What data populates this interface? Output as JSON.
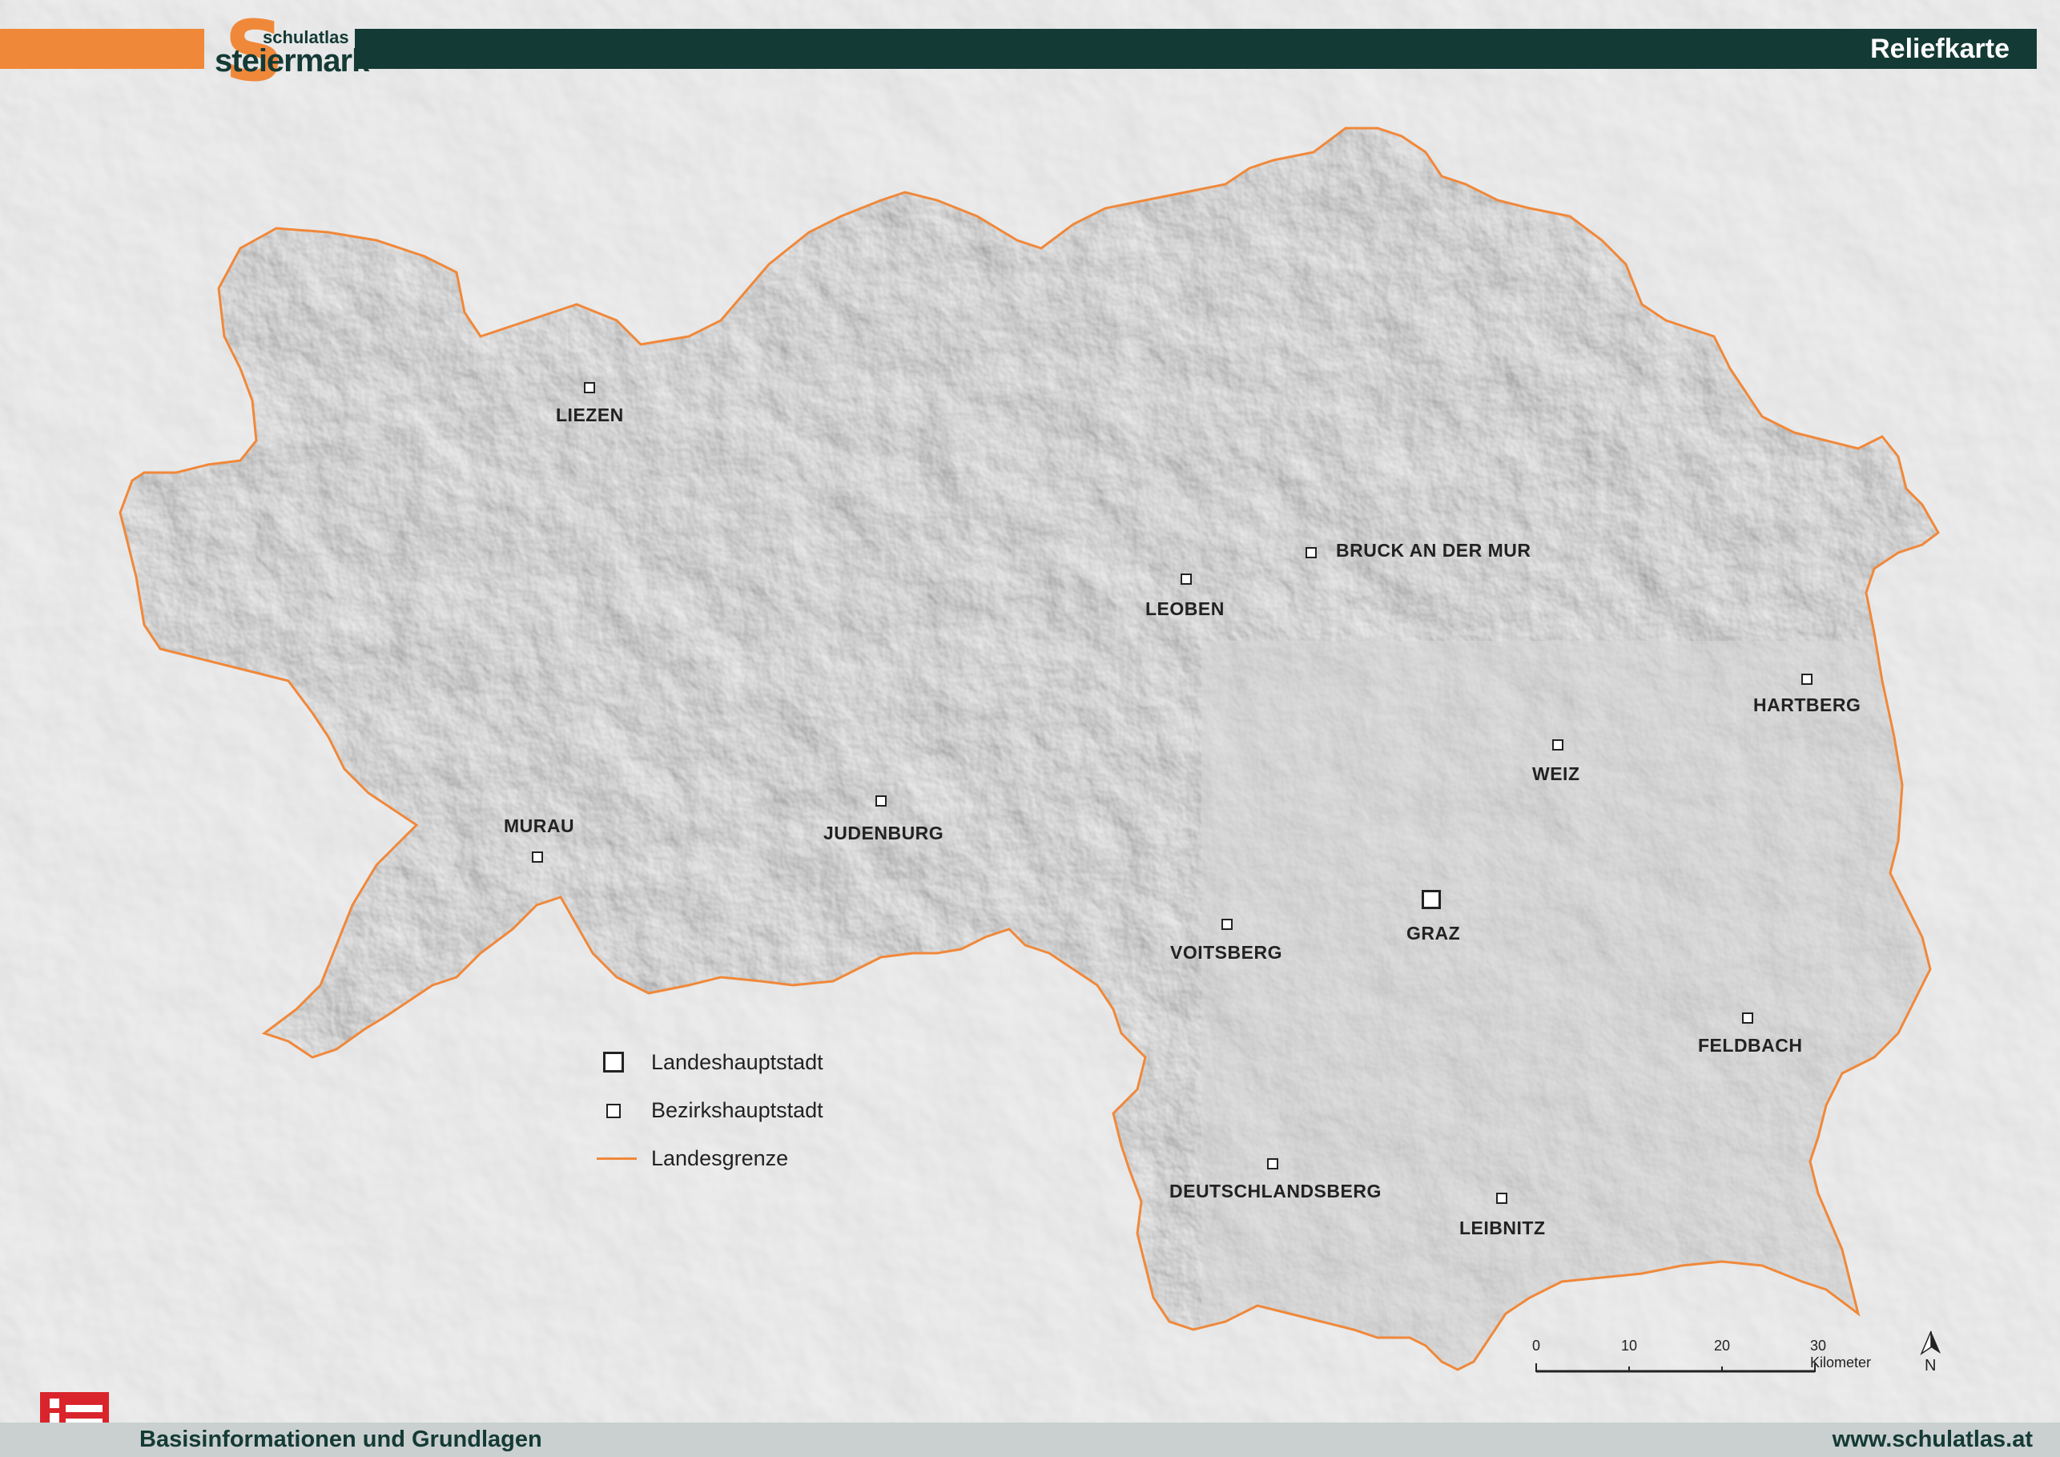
{
  "header": {
    "title": "Reliefkarte",
    "logo_small": "schulatlas",
    "logo_big": "steiermark",
    "logo_letter": "S",
    "accent_color": "#f0883a",
    "dark_color": "#143a35"
  },
  "footer": {
    "left_text": "Basisinformationen und Grundlagen",
    "right_text": "www.schulatlas.at"
  },
  "cities": [
    {
      "name": "LIEZEN",
      "type": "district"
    },
    {
      "name": "BRUCK AN DER MUR",
      "type": "district"
    },
    {
      "name": "LEOBEN",
      "type": "district"
    },
    {
      "name": "HARTBERG",
      "type": "district"
    },
    {
      "name": "WEIZ",
      "type": "district"
    },
    {
      "name": "MURAU",
      "type": "district"
    },
    {
      "name": "JUDENBURG",
      "type": "district"
    },
    {
      "name": "GRAZ",
      "type": "capital"
    },
    {
      "name": "VOITSBERG",
      "type": "district"
    },
    {
      "name": "FELDBACH",
      "type": "district"
    },
    {
      "name": "DEUTSCHLANDSBERG",
      "type": "district"
    },
    {
      "name": "LEIBNITZ",
      "type": "district"
    }
  ],
  "legend": {
    "capital": "Landeshauptstadt",
    "district": "Bezirkshauptstadt",
    "border": "Landesgrenze"
  },
  "scale": {
    "ticks": [
      "0",
      "10",
      "20",
      "30 Kilometer"
    ]
  },
  "north_arrow": "N",
  "border_color": "#f0883a"
}
